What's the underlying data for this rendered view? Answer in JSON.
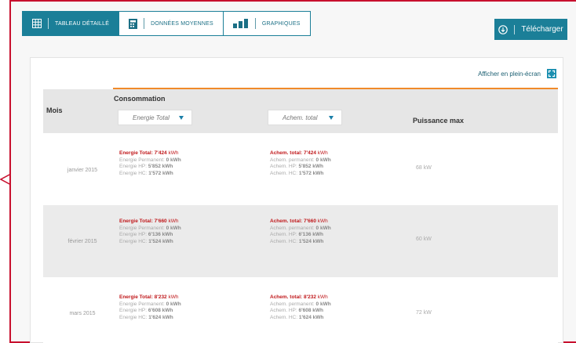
{
  "toolbar": {
    "tabs": [
      {
        "label": "Tableau détaillé",
        "icon": "grid-icon",
        "active": true
      },
      {
        "label": "Données moyennes",
        "icon": "calculator-icon",
        "active": false
      },
      {
        "label": "Graphiques",
        "icon": "bar-chart-icon",
        "active": false
      }
    ]
  },
  "download": {
    "label": "Télécharger",
    "icon": "download-cloud-icon"
  },
  "fullscreen": {
    "label": "Afficher en plein-écran",
    "icon": "fullscreen-icon"
  },
  "table": {
    "header_mois": "Mois",
    "header_consommation": "Consommation",
    "header_puissance": "Puissance max",
    "select_energie": "Energie Total",
    "select_achem": "Achem. total",
    "rows": [
      {
        "month": "janvier 2015",
        "energie_total": "Energie Total: 7'424",
        "energie_permanent": "Energie Permanent:",
        "energie_permanent_val": "0 kWh",
        "energie_hp": "Energie HP:",
        "energie_hp_val": "5'852 kWh",
        "energie_hc": "Energie HC:",
        "energie_hc_val": "1'572 kWh",
        "achem_total": "Achem. total: 7'424",
        "achem_permanent": "Achem. permanent:",
        "achem_permanent_val": "0 kWh",
        "achem_hp": "Achem. HP:",
        "achem_hp_val": "5'852 kWh",
        "achem_hc": "Achem. HC:",
        "achem_hc_val": "1'572 kWh",
        "puissance": "68 kW"
      },
      {
        "month": "février 2015",
        "energie_total": "Energie Total: 7'660",
        "energie_permanent": "Energie Permanent:",
        "energie_permanent_val": "0 kWh",
        "energie_hp": "Energie HP:",
        "energie_hp_val": "6'136 kWh",
        "energie_hc": "Energie HC:",
        "energie_hc_val": "1'524 kWh",
        "achem_total": "Achem. total: 7'660",
        "achem_permanent": "Achem. permanent:",
        "achem_permanent_val": "0 kWh",
        "achem_hp": "Achem. HP:",
        "achem_hp_val": "6'136 kWh",
        "achem_hc": "Achem. HC:",
        "achem_hc_val": "1'524 kWh",
        "puissance": "60 kW"
      },
      {
        "month": "mars 2015",
        "energie_total": "Energie Total: 8'232",
        "energie_permanent": "Energie Permanent:",
        "energie_permanent_val": "0 kWh",
        "energie_hp": "Energie HP:",
        "energie_hp_val": "6'608 kWh",
        "energie_hc": "Energie HC:",
        "energie_hc_val": "1'624 kWh",
        "achem_total": "Achem. total: 8'232",
        "achem_permanent": "Achem. permanent:",
        "achem_permanent_val": "0 kWh",
        "achem_hp": "Achem. HP:",
        "achem_hp_val": "6'608 kWh",
        "achem_hc": "Achem. HC:",
        "achem_hc_val": "1'624 kWh",
        "puissance": "72 kW"
      }
    ],
    "unit": "kWh"
  },
  "colors": {
    "accent": "#1b7f98",
    "highlight": "#f08a2a",
    "red": "#c0181b"
  }
}
